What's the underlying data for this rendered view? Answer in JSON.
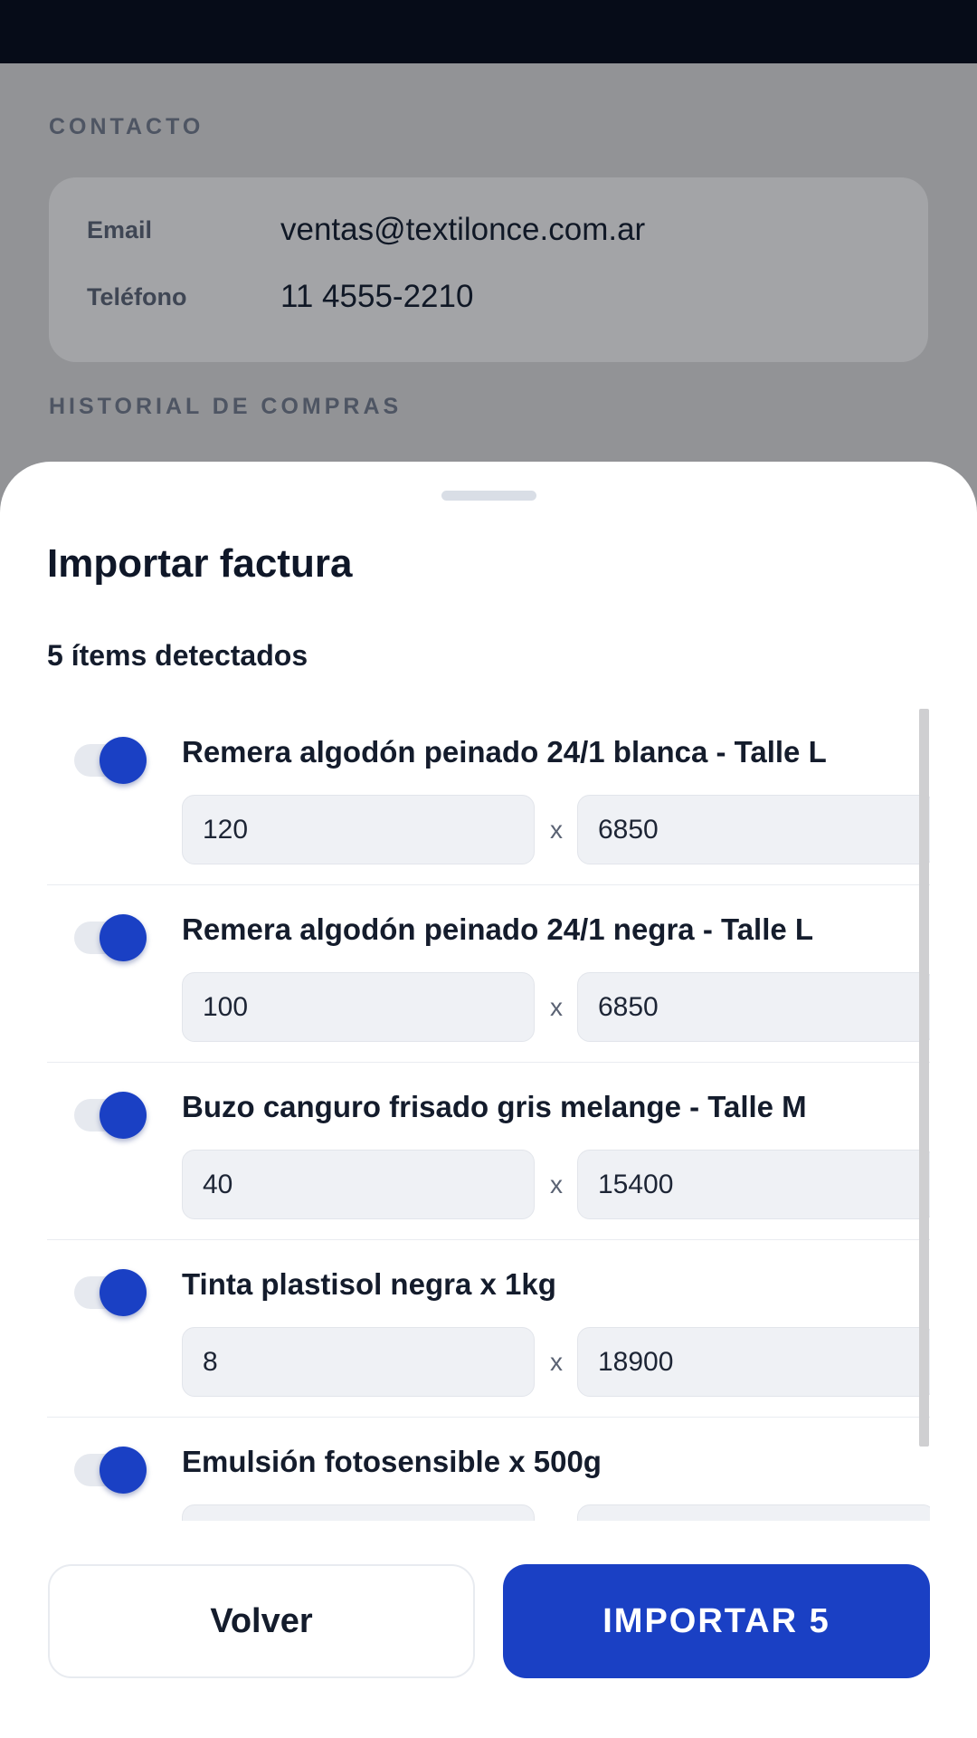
{
  "background": {
    "contact_section_label": "CONTACTO",
    "contact": [
      {
        "key": "Email",
        "value": "ventas@textilonce.com.ar"
      },
      {
        "key": "Teléfono",
        "value": "11 4555-2210"
      }
    ],
    "history_section_label": "HISTORIAL DE COMPRAS"
  },
  "sheet": {
    "title": "Importar factura",
    "subtitle": "5 ítems detectados",
    "times_symbol": "x",
    "items": [
      {
        "name": "Remera algodón peinado 24/1 blanca - Talle L",
        "quantity": "120",
        "unit_price": "6850",
        "enabled": true
      },
      {
        "name": "Remera algodón peinado 24/1 negra - Talle L",
        "quantity": "100",
        "unit_price": "6850",
        "enabled": true
      },
      {
        "name": "Buzo canguro frisado gris melange - Talle M",
        "quantity": "40",
        "unit_price": "15400",
        "enabled": true
      },
      {
        "name": "Tinta plastisol negra x 1kg",
        "quantity": "8",
        "unit_price": "18900",
        "enabled": true
      },
      {
        "name": "Emulsión fotosensible x 500g",
        "quantity": "",
        "unit_price": "",
        "enabled": true
      }
    ],
    "back_label": "Volver",
    "import_label": "IMPORTAR 5"
  },
  "colors": {
    "accent": "#1a40c4",
    "status_bar": "#060c18",
    "scrim": "#929396",
    "sheet_bg": "#ffffff"
  }
}
